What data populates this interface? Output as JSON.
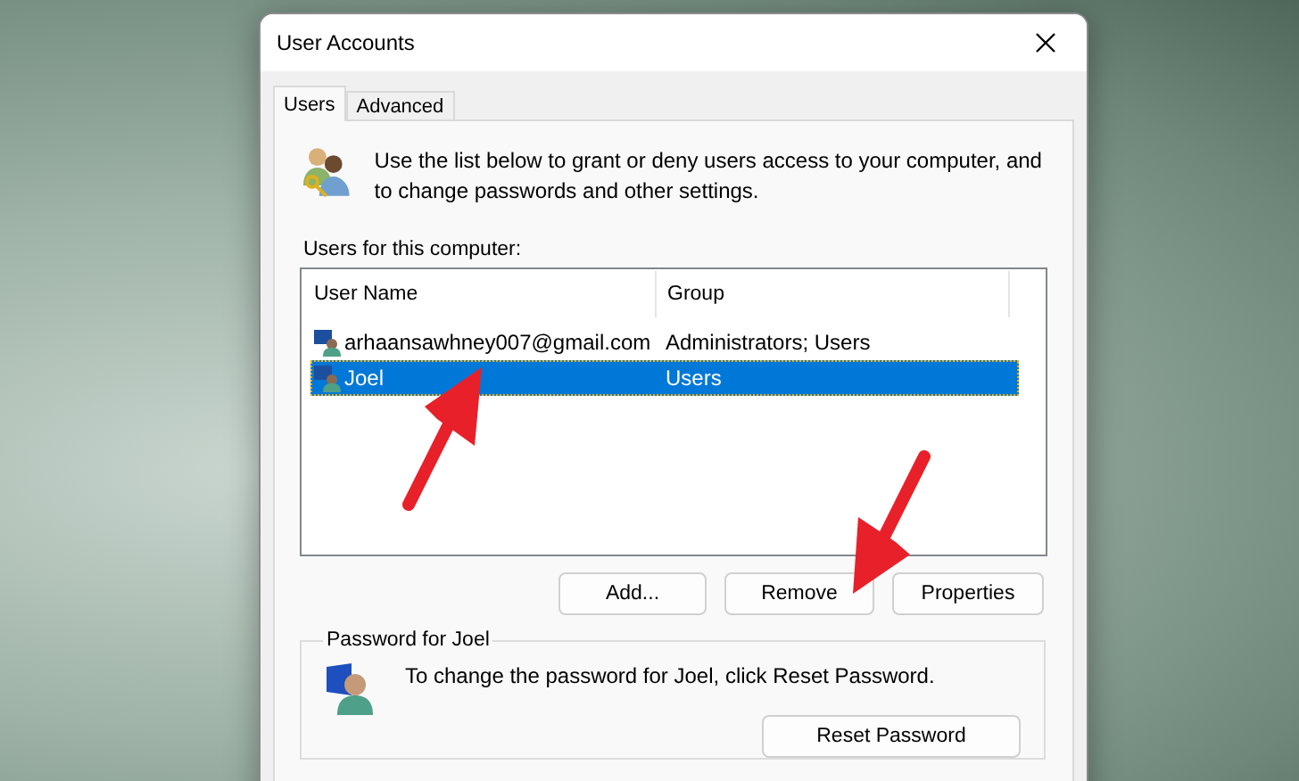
{
  "window": {
    "title": "User Accounts"
  },
  "tabs": [
    {
      "label": "Users",
      "selected": true
    },
    {
      "label": "Advanced",
      "selected": false
    }
  ],
  "intro": "Use the list below to grant or deny users access to your computer, and to change passwords and other settings.",
  "users_label": "Users for this computer:",
  "table": {
    "columns": [
      "User Name",
      "Group"
    ],
    "rows": [
      {
        "name": "arhaansawhney007@gmail.com",
        "group": "Administrators; Users",
        "selected": false
      },
      {
        "name": "Joel",
        "group": "Users",
        "selected": true
      }
    ]
  },
  "buttons": [
    "Add...",
    "Remove",
    "Properties"
  ],
  "password_group": {
    "title": "Password for Joel",
    "text": "To change the password for Joel, click Reset Password.",
    "button": "Reset Password"
  }
}
